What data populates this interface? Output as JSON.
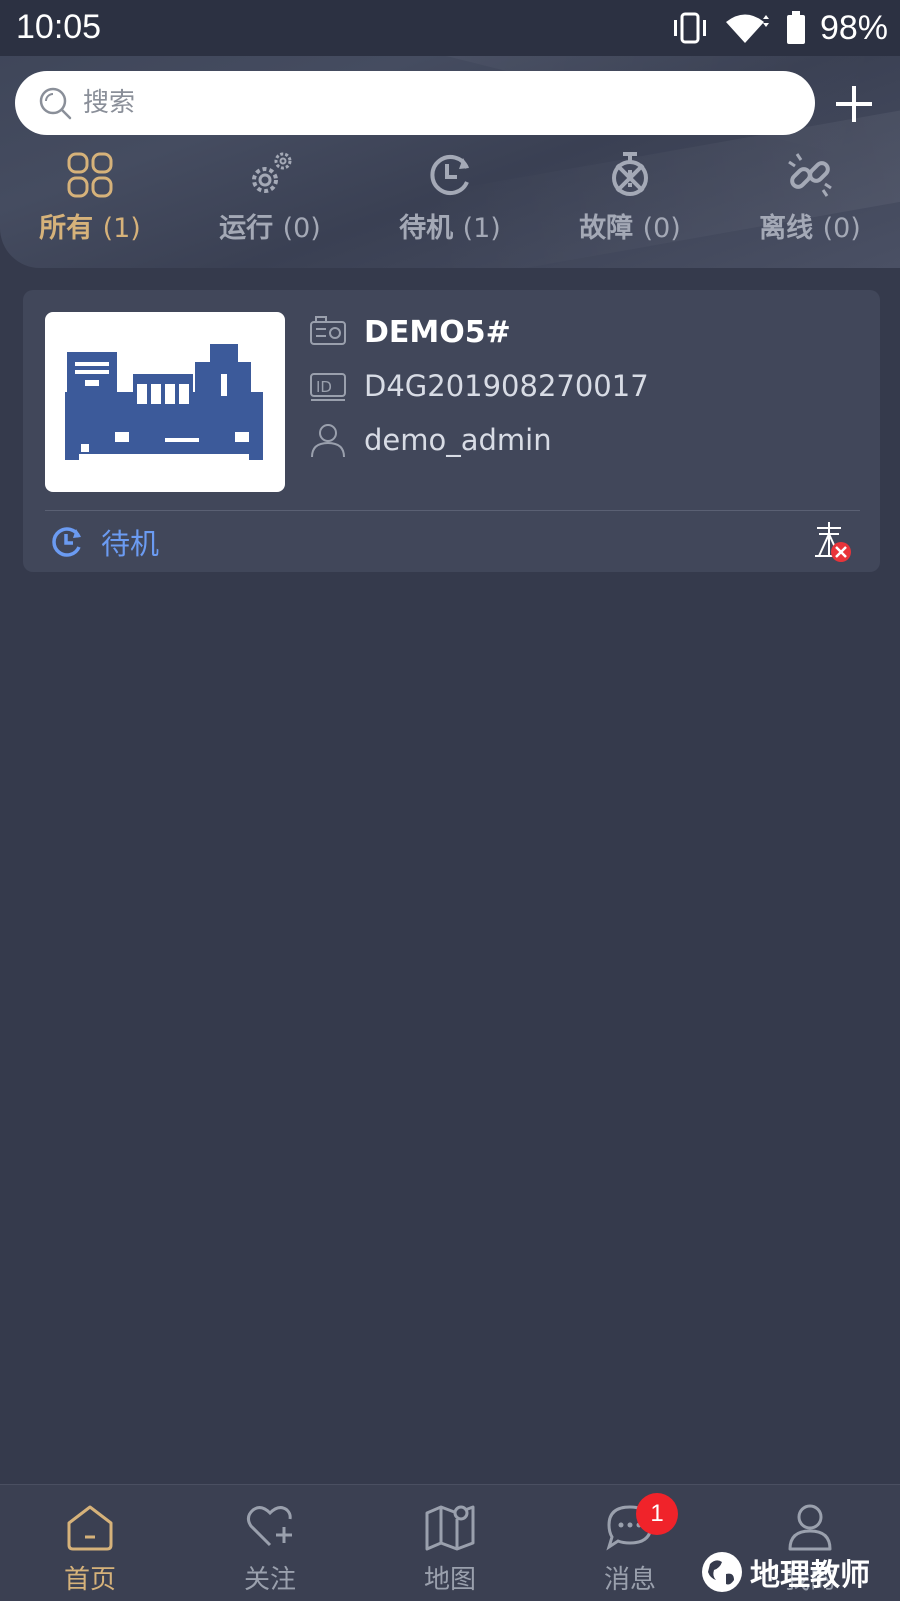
{
  "status_bar": {
    "time": "10:05",
    "battery_percent": "98%",
    "icons": [
      "vibrate-icon",
      "wifi-icon",
      "battery-icon"
    ]
  },
  "search": {
    "placeholder": "搜索",
    "value": ""
  },
  "add_button_icon": "plus-icon",
  "filter_tabs": [
    {
      "label": "所有",
      "count": "(1)",
      "icon": "grid-icon",
      "active": true
    },
    {
      "label": "运行",
      "count": "(0)",
      "icon": "gears-icon",
      "active": false
    },
    {
      "label": "待机",
      "count": "(1)",
      "icon": "standby-clock-icon",
      "active": false
    },
    {
      "label": "故障",
      "count": "(0)",
      "icon": "fault-alarm-icon",
      "active": false
    },
    {
      "label": "离线",
      "count": "(0)",
      "icon": "broken-link-icon",
      "active": false
    }
  ],
  "device_card": {
    "name": "DEMO5#",
    "serial": "D4G201908270017",
    "owner": "demo_admin",
    "status_label": "待机",
    "image": "generator-image",
    "power_icon": "power-line-offline-icon"
  },
  "bottom_nav": [
    {
      "label": "首页",
      "icon": "home-icon",
      "active": true,
      "badge": ""
    },
    {
      "label": "关注",
      "icon": "heart-plus-icon",
      "active": false,
      "badge": ""
    },
    {
      "label": "地图",
      "icon": "map-icon",
      "active": false,
      "badge": ""
    },
    {
      "label": "消息",
      "icon": "chat-icon",
      "active": false,
      "badge": "1"
    },
    {
      "label": "我的",
      "icon": "person-icon",
      "active": false,
      "badge": ""
    }
  ],
  "watermark": {
    "text": "地理教师"
  },
  "colors": {
    "accent_gold": "#d6b27a",
    "standby_blue": "#6b9bf2",
    "background": "#353a4c",
    "card": "#41475a",
    "badge_red": "#f0232a"
  }
}
